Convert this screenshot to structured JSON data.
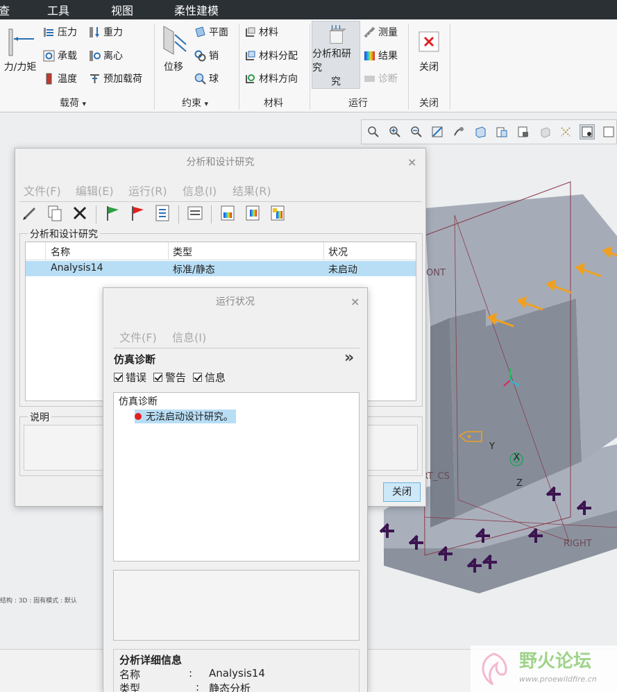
{
  "menubar": {
    "items": [
      "查",
      "工具",
      "视图",
      "柔性建模"
    ]
  },
  "ribbon": {
    "load_group": {
      "big_button": "力/力矩",
      "items": [
        "压力",
        "承载",
        "温度",
        "重力",
        "离心",
        "预加载荷"
      ],
      "label": "载荷",
      "dropdown_glyph": "▾"
    },
    "constraint_group": {
      "big_button": "位移",
      "items": [
        "平面",
        "销",
        "球"
      ],
      "label": "约束",
      "dropdown_glyph": "▾"
    },
    "material_group": {
      "items": [
        "材料",
        "材料分配",
        "材料方向"
      ],
      "label": "材料"
    },
    "run_group": {
      "big_button": "分析和研究",
      "items": [
        "测量",
        "结果",
        "诊断"
      ],
      "label": "运行"
    },
    "close_group": {
      "big_button": "关闭",
      "label": "关闭"
    }
  },
  "viewport": {
    "labels": {
      "front": "ONT",
      "right": "RIGHT",
      "csys": "RT_CS",
      "y": "Y",
      "x": "X",
      "z": "Z"
    },
    "status_strip": "结构  :  3D  :  固有模式  :  默认"
  },
  "analysis_dialog": {
    "title": "分析和设计研究",
    "close_glyph": "×",
    "menu": [
      "文件(F)",
      "编辑(E)",
      "运行(R)",
      "信息(I)",
      "结果(R)"
    ],
    "list_frame_label": "分析和设计研究",
    "columns": [
      "名称",
      "类型",
      "状况"
    ],
    "rows": [
      {
        "name": "Analysis14",
        "type": "标准/静态",
        "status": "未启动"
      }
    ],
    "description_label": "说明",
    "close_button": "关闭"
  },
  "run_status_dialog": {
    "title": "运行状况",
    "close_glyph": "×",
    "menu": [
      "文件(F)",
      "信息(I)"
    ],
    "diagnostics_title": "仿真诊断",
    "expand_glyph": "»",
    "filters": [
      "错误",
      "警告",
      "信息"
    ],
    "tree_root": "仿真诊断",
    "message": "无法启动设计研究。",
    "details_title": "分析详细信息",
    "details": [
      {
        "key": "名称",
        "sep": ":",
        "value": "Analysis14"
      },
      {
        "key": "类型",
        "sep": ":",
        "value": "静态分析"
      }
    ]
  },
  "watermark": {
    "text": "野火论坛",
    "url": "www.proewildfire.cn"
  },
  "colors": {
    "menubar_bg": "#2b3034",
    "selection": "#b8def5",
    "model_gray": "#8b929e",
    "arrow_orange": "#f0a020",
    "constraint_purple": "#3c1450",
    "error_red": "#e02020"
  }
}
